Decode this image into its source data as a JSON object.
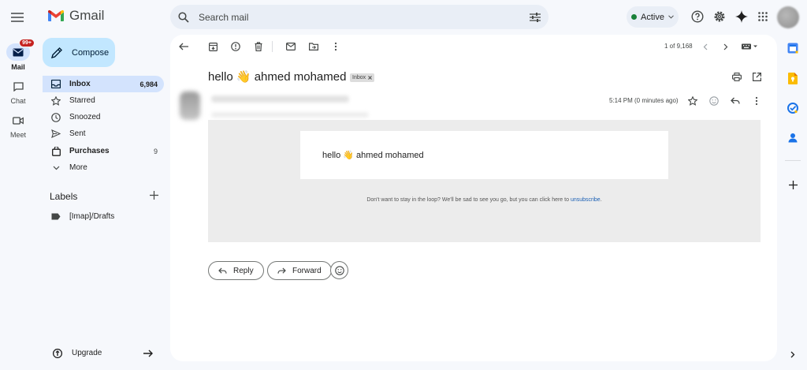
{
  "app": {
    "name": "Gmail"
  },
  "search": {
    "placeholder": "Search mail"
  },
  "status": {
    "label": "Active"
  },
  "rail": {
    "mail": {
      "label": "Mail",
      "badge": "99+"
    },
    "chat": {
      "label": "Chat"
    },
    "meet": {
      "label": "Meet"
    }
  },
  "compose": {
    "label": "Compose"
  },
  "nav": [
    {
      "label": "Inbox",
      "count": "6,984",
      "icon": "inbox-icon"
    },
    {
      "label": "Starred",
      "count": "",
      "icon": "star-icon"
    },
    {
      "label": "Snoozed",
      "count": "",
      "icon": "clock-icon"
    },
    {
      "label": "Sent",
      "count": "",
      "icon": "send-icon"
    },
    {
      "label": "Purchases",
      "count": "9",
      "icon": "tag-icon"
    },
    {
      "label": "More",
      "count": "",
      "icon": "chevron-down-icon"
    }
  ],
  "labels": {
    "heading": "Labels",
    "items": [
      {
        "label": "[Imap]/Drafts"
      }
    ]
  },
  "upgrade": {
    "label": "Upgrade"
  },
  "pager": {
    "text": "1 of 9,168"
  },
  "message": {
    "subject": "hello 👋 ahmed mohamed",
    "tag": "Inbox",
    "timestamp": "5:14 PM (0 minutes ago)",
    "body_text": "hello 👋 ahmed mohamed",
    "footer_text": "Don't want to stay in the loop? We'll be sad to see you go, but you can click here to",
    "unsubscribe_label": "unsubscribe",
    "footer_end": "."
  },
  "actions": {
    "reply": "Reply",
    "forward": "Forward"
  },
  "colors": {
    "accent": "#c2e7ff",
    "selected": "#d3e3fd",
    "background": "#f6f8fc",
    "gmail_red": "#ea4335"
  }
}
